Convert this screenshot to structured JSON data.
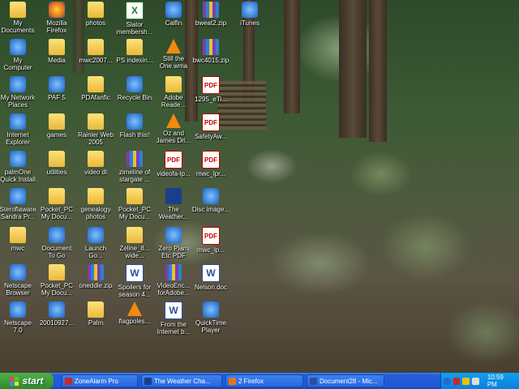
{
  "desktop_icons": [
    {
      "label": "My\nDocuments",
      "icon": "my-documents-icon",
      "type": "folder"
    },
    {
      "label": "Mozilla\nFirefox",
      "icon": "firefox-icon",
      "type": "firefox"
    },
    {
      "label": "photos",
      "icon": "folder-icon",
      "type": "folder"
    },
    {
      "label": "Slator\nmembersh...",
      "icon": "excel-file-icon",
      "type": "excel"
    },
    {
      "label": "Calfin",
      "icon": "app-icon",
      "type": "sys"
    },
    {
      "label": "bweat2.zip",
      "icon": "zip-icon",
      "type": "zip"
    },
    {
      "label": "iTunes",
      "icon": "itunes-icon",
      "type": "sys"
    },
    {
      "label": "My\nComputer",
      "icon": "my-computer-icon",
      "type": "sys"
    },
    {
      "label": "Media",
      "icon": "folder-icon",
      "type": "folder"
    },
    {
      "label": "mwc2007...",
      "icon": "folder-icon",
      "type": "folder"
    },
    {
      "label": "PS indexin...",
      "icon": "folder-icon",
      "type": "folder"
    },
    {
      "label": "Still the\nOne.wma",
      "icon": "vlc-icon",
      "type": "cone"
    },
    {
      "label": "bwc4015.zip",
      "icon": "zip-icon",
      "type": "zip"
    },
    {
      "label": "My Network\nPlaces",
      "icon": "network-places-icon",
      "type": "sys"
    },
    {
      "label": "PAF 5",
      "icon": "paf-icon",
      "type": "sys"
    },
    {
      "label": "PDAfanfic",
      "icon": "folder-icon",
      "type": "folder"
    },
    {
      "label": "Recycle Bin",
      "icon": "recycle-bin-icon",
      "type": "sys"
    },
    {
      "label": "Adobe\nReade...",
      "icon": "folder-icon",
      "type": "folder"
    },
    {
      "label": "1295_eTi...",
      "icon": "pdf-icon",
      "type": "pdf"
    },
    {
      "label": "Internet\nExplorer",
      "icon": "internet-explorer-icon",
      "type": "sys"
    },
    {
      "label": "games",
      "icon": "folder-icon",
      "type": "folder"
    },
    {
      "label": "Rainier Web\n2005",
      "icon": "folder-icon",
      "type": "folder"
    },
    {
      "label": "Flash this!",
      "icon": "flash-icon",
      "type": "sys"
    },
    {
      "label": "Oz and\nJames Dri...",
      "icon": "vlc-icon",
      "type": "cone"
    },
    {
      "label": "SafetyAw...",
      "icon": "pdf-icon",
      "type": "pdf"
    },
    {
      "label": "palmOne\nQuick Install",
      "icon": "palmone-icon",
      "type": "sys"
    },
    {
      "label": "utilities",
      "icon": "folder-icon",
      "type": "folder"
    },
    {
      "label": "video dl",
      "icon": "folder-icon",
      "type": "folder"
    },
    {
      "label": "zimeline of\nstargate ...",
      "icon": "zip-icon",
      "type": "zip"
    },
    {
      "label": "videofa-lp...",
      "icon": "pdf-icon",
      "type": "pdf"
    },
    {
      "label": "mwc_lpr...",
      "icon": "pdf-icon",
      "type": "pdf"
    },
    {
      "label": "Steroflaware\nSandra Pr...",
      "icon": "sandra-icon",
      "type": "sys"
    },
    {
      "label": "Pocket_PC\nMy Docu...",
      "icon": "sync-folder-icon",
      "type": "folder"
    },
    {
      "label": "genealogy\nphotos",
      "icon": "folder-icon",
      "type": "folder"
    },
    {
      "label": "Pocket_PC\nMy Docu...",
      "icon": "sync-folder-icon",
      "type": "folder"
    },
    {
      "label": "The\nWeather...",
      "icon": "weather-icon",
      "type": "weather"
    },
    {
      "label": "Disc image...",
      "icon": "disc-icon",
      "type": "sys"
    },
    {
      "label": "mwc",
      "icon": "folder-icon",
      "type": "folder"
    },
    {
      "label": "Document\nTo Go",
      "icon": "documents-to-go-icon",
      "type": "sys"
    },
    {
      "label": "Launch\nGo...",
      "icon": "google-earth-icon",
      "type": "sys"
    },
    {
      "label": "Zeline_8...\nwide...",
      "icon": "folder-icon",
      "type": "folder"
    },
    {
      "label": "Zero Plam\nEtc PDF",
      "icon": "app-icon",
      "type": "sys"
    },
    {
      "label": "mwc_lp...",
      "icon": "pdf-icon",
      "type": "pdf"
    },
    {
      "label": "Netscape\nBrowser",
      "icon": "netscape-icon",
      "type": "sys"
    },
    {
      "label": "Pocket_PC\nMy Docu...",
      "icon": "sync-folder-icon",
      "type": "folder"
    },
    {
      "label": "oneddle.zip",
      "icon": "zip-icon",
      "type": "zip"
    },
    {
      "label": "Spoilers for\nseason 4...",
      "icon": "word-doc-icon",
      "type": "doc"
    },
    {
      "label": "VideoEnc...\nforAdobe...",
      "icon": "zip-icon",
      "type": "zip"
    },
    {
      "label": "Nelson.doc",
      "icon": "word-doc-icon",
      "type": "doc"
    },
    {
      "label": "Netscape\n7.0",
      "icon": "netscape-icon",
      "type": "sys"
    },
    {
      "label": "20010927...",
      "icon": "camera-icon",
      "type": "sys"
    },
    {
      "label": "Palm",
      "icon": "folder-icon",
      "type": "folder"
    },
    {
      "label": "flagpoles...",
      "icon": "vlc-icon",
      "type": "cone"
    },
    {
      "label": "From the\nInternet b...",
      "icon": "word-doc-icon",
      "type": "doc"
    },
    {
      "label": "QuickTime\nPlayer",
      "icon": "quicktime-icon",
      "type": "sys"
    }
  ],
  "taskbar": {
    "start_label": "start",
    "tasks": [
      {
        "label": "ZoneAlarm Pro",
        "color": "#c62828"
      },
      {
        "label": "The Weather Cha...",
        "color": "#1a3f8a"
      },
      {
        "label": "2 Firefox",
        "color": "#e8731c"
      },
      {
        "label": "Document28 - Mic...",
        "color": "#2a4fa0"
      }
    ],
    "clock": "10:59 PM"
  }
}
